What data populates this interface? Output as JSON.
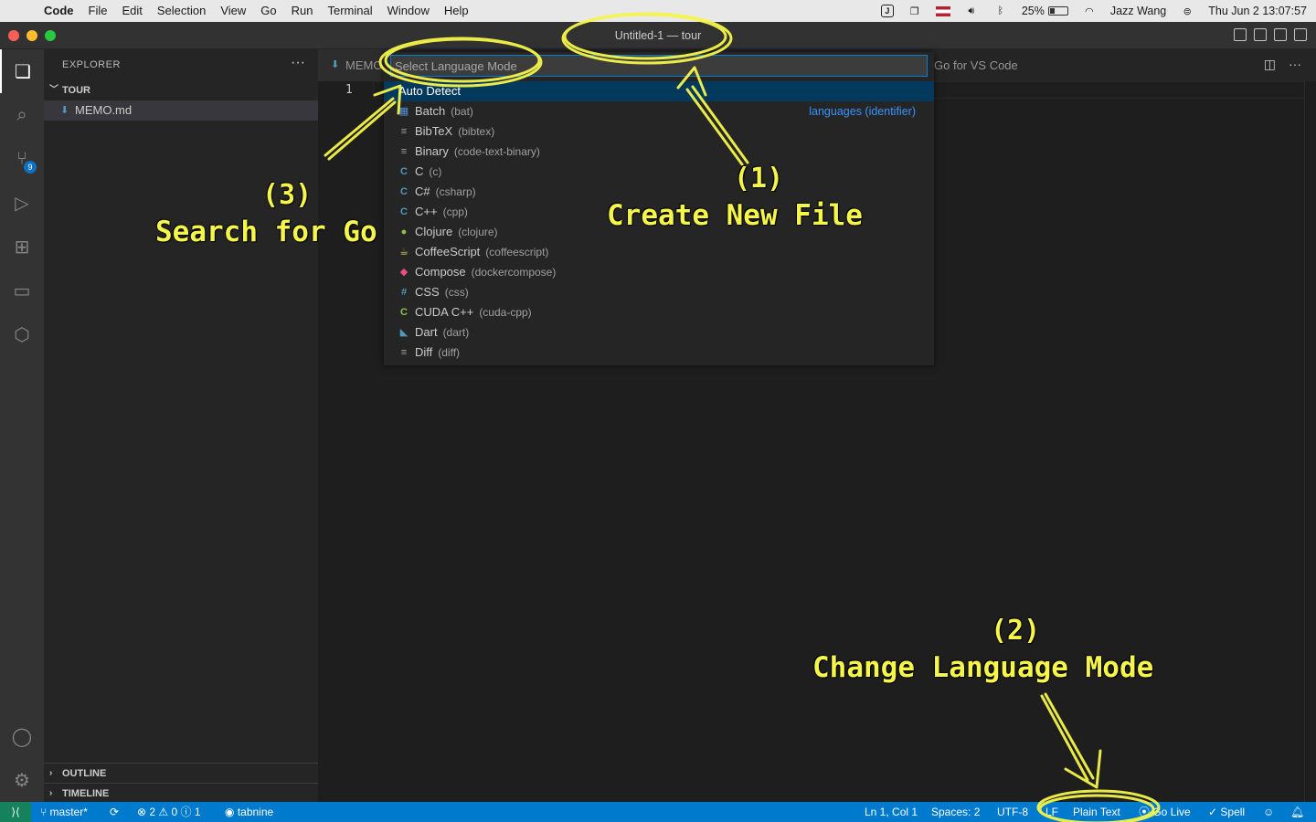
{
  "menubar": {
    "items": [
      "Code",
      "File",
      "Edit",
      "Selection",
      "View",
      "Go",
      "Run",
      "Terminal",
      "Window",
      "Help"
    ],
    "battery": "25%",
    "battery_level": 0.25,
    "user": "Jazz Wang",
    "datetime": "Thu Jun 2  13:07:57"
  },
  "window": {
    "title": "Untitled-1 — tour"
  },
  "activity": {
    "scm_badge": "9"
  },
  "sidebar": {
    "title": "EXPLORER",
    "more": "···",
    "folder": "TOUR",
    "file": "MEMO.md",
    "outline": "OUTLINE",
    "timeline": "TIMELINE"
  },
  "tabs": {
    "tab1": "MEMO",
    "tab2": "Go for VS Code"
  },
  "editor": {
    "line_number": "1"
  },
  "quickpick": {
    "placeholder": "Select Language Mode",
    "group_label": "languages (identifier)",
    "items": [
      {
        "label": "Auto Detect",
        "desc": "",
        "icon": "",
        "color": "#ffffff"
      },
      {
        "label": "Batch",
        "desc": "(bat)",
        "icon": "▦",
        "color": "#4f8fd8"
      },
      {
        "label": "BibTeX",
        "desc": "(bibtex)",
        "icon": "≡",
        "color": "#a0a0a0"
      },
      {
        "label": "Binary",
        "desc": "(code-text-binary)",
        "icon": "≡",
        "color": "#a0a0a0"
      },
      {
        "label": "C",
        "desc": "(c)",
        "icon": "C",
        "color": "#519aba"
      },
      {
        "label": "C#",
        "desc": "(csharp)",
        "icon": "C",
        "color": "#519aba"
      },
      {
        "label": "C++",
        "desc": "(cpp)",
        "icon": "C",
        "color": "#519aba"
      },
      {
        "label": "Clojure",
        "desc": "(clojure)",
        "icon": "●",
        "color": "#8dc149"
      },
      {
        "label": "CoffeeScript",
        "desc": "(coffeescript)",
        "icon": "☕",
        "color": "#cbcb41"
      },
      {
        "label": "Compose",
        "desc": "(dockercompose)",
        "icon": "◆",
        "color": "#e8508a"
      },
      {
        "label": "CSS",
        "desc": "(css)",
        "icon": "#",
        "color": "#519aba"
      },
      {
        "label": "CUDA C++",
        "desc": "(cuda-cpp)",
        "icon": "C",
        "color": "#8dc149"
      },
      {
        "label": "Dart",
        "desc": "(dart)",
        "icon": "◣",
        "color": "#519aba"
      },
      {
        "label": "Diff",
        "desc": "(diff)",
        "icon": "≡",
        "color": "#a0a0a0"
      }
    ]
  },
  "statusbar": {
    "branch": "master*",
    "problems": "⊗ 2 ⚠ 0 ⓘ 1",
    "tabnine": "tabnine",
    "position": "Ln 1, Col 1",
    "spaces": "Spaces: 2",
    "encoding": "UTF-8",
    "eol": "LF",
    "language": "Plain Text",
    "golive": "Go Live",
    "spell": "✓ Spell"
  },
  "annotations": {
    "a1_num": "(1)",
    "a1_text": "Create New File",
    "a2_num": "(2)",
    "a2_text": "Change Language Mode",
    "a3_num": "(3)",
    "a3_text": "Search for Go"
  }
}
